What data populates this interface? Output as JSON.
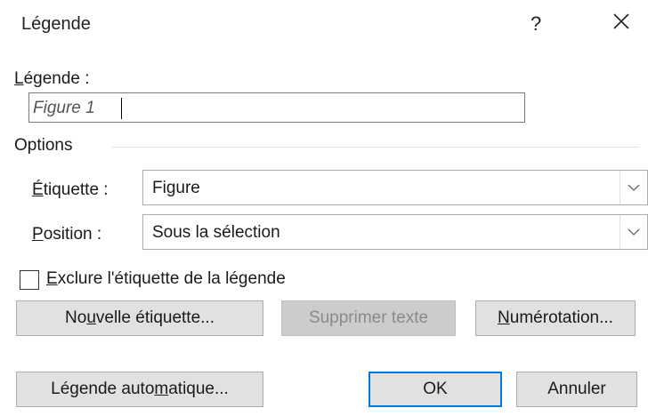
{
  "dialog": {
    "title": "Légende",
    "help": "?",
    "close_icon": "close-icon"
  },
  "caption": {
    "label_u": "L",
    "label_rest": "égende :",
    "value": "Figure 1"
  },
  "options": {
    "group_label": "Options",
    "label_field": {
      "label_u": "É",
      "label_rest": "tiquette :",
      "value": "Figure"
    },
    "position_field": {
      "label_u": "P",
      "label_rest": "osition :",
      "value": "Sous la sélection"
    },
    "exclude_checkbox": {
      "label_u": "E",
      "label_rest": "xclure l'étiquette de la légende",
      "checked": false
    }
  },
  "buttons": {
    "new_label_pre": "No",
    "new_label_u": "u",
    "new_label_post": "velle étiquette...",
    "delete_label": "Supprimer texte",
    "numbering_u": "N",
    "numbering_rest": "umérotation...",
    "autocaption_pre": "Légende auto",
    "autocaption_u": "m",
    "autocaption_post": "atique...",
    "ok": "OK",
    "cancel": "Annuler"
  },
  "colors": {
    "accent": "#0078d7",
    "button_bg": "#e1e1e1",
    "disabled_bg": "#cccccc"
  }
}
